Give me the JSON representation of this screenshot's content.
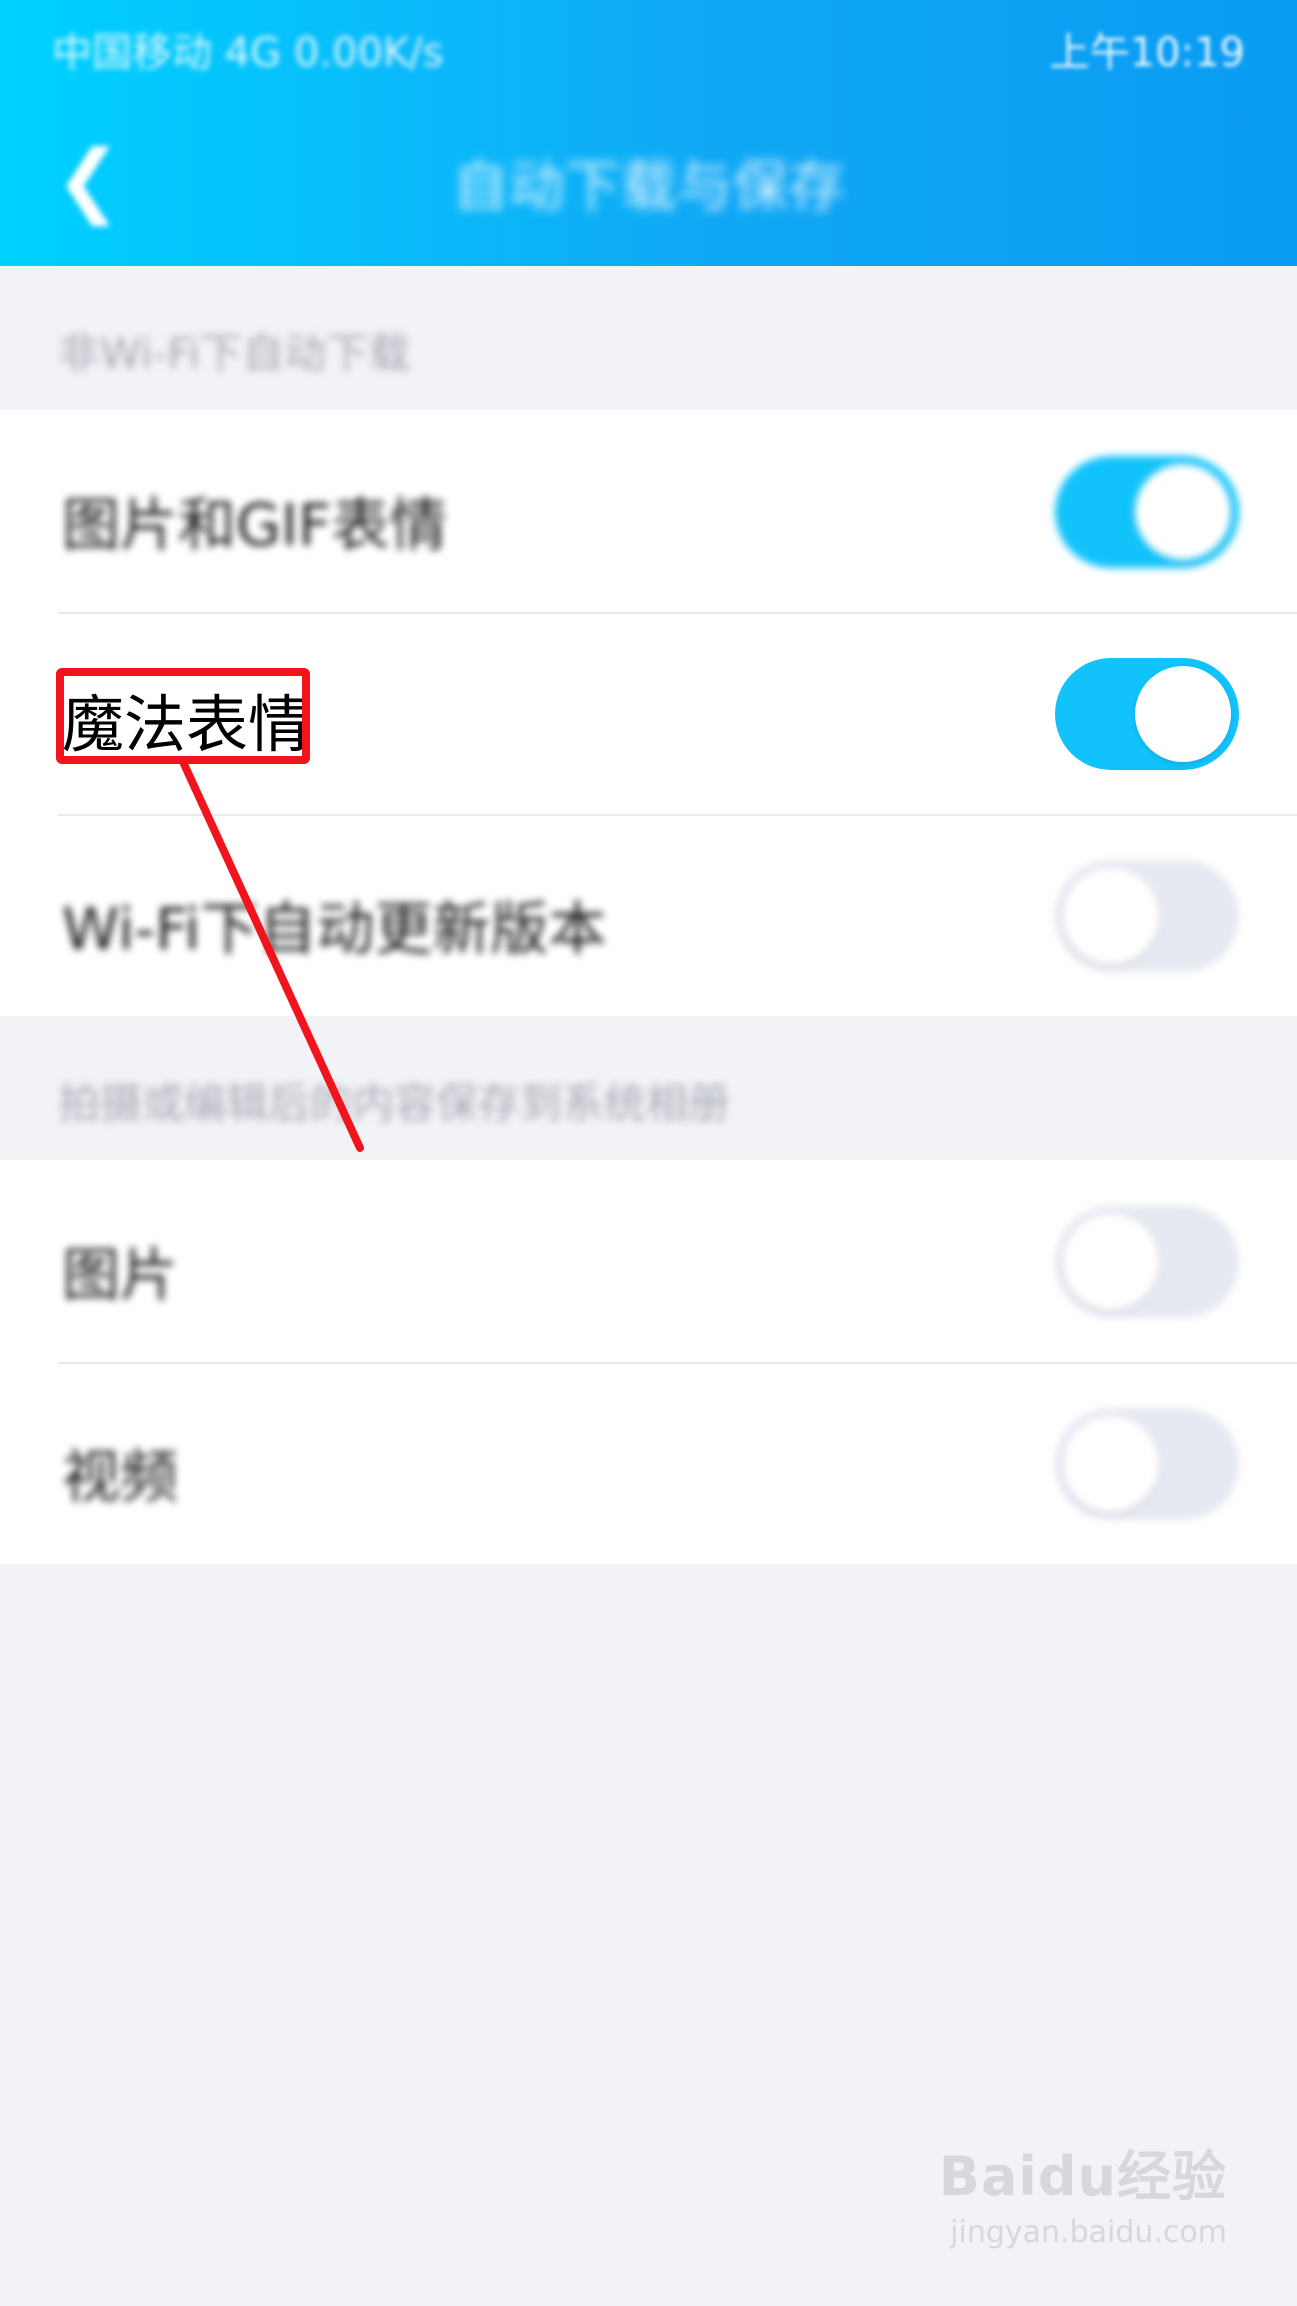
{
  "status_bar": {
    "left_text": "中国移动 4G 0.00K/s",
    "right_text": "上午10:19"
  },
  "nav": {
    "title": "自动下载与保存"
  },
  "sections": [
    {
      "label": "非Wi-Fi下自动下载",
      "rows": [
        {
          "label": "图片和GIF表情",
          "on": true
        },
        {
          "label": "魔法表情",
          "on": true
        },
        {
          "label": "Wi-Fi下自动更新版本",
          "on": false
        }
      ]
    },
    {
      "label": "拍摄或编辑后的内容保存到系统相册",
      "rows": [
        {
          "label": "图片",
          "on": false
        },
        {
          "label": "视频",
          "on": false
        }
      ]
    }
  ],
  "watermark": {
    "logo": "Baidu经验",
    "url": "jingyan.baidu.com"
  },
  "colors": {
    "header_start": "#00d2ff",
    "header_end": "#0a9bf2",
    "toggle_on": "#12c3fb",
    "toggle_off": "#e6e9f1",
    "annotation": "#f2141c"
  }
}
